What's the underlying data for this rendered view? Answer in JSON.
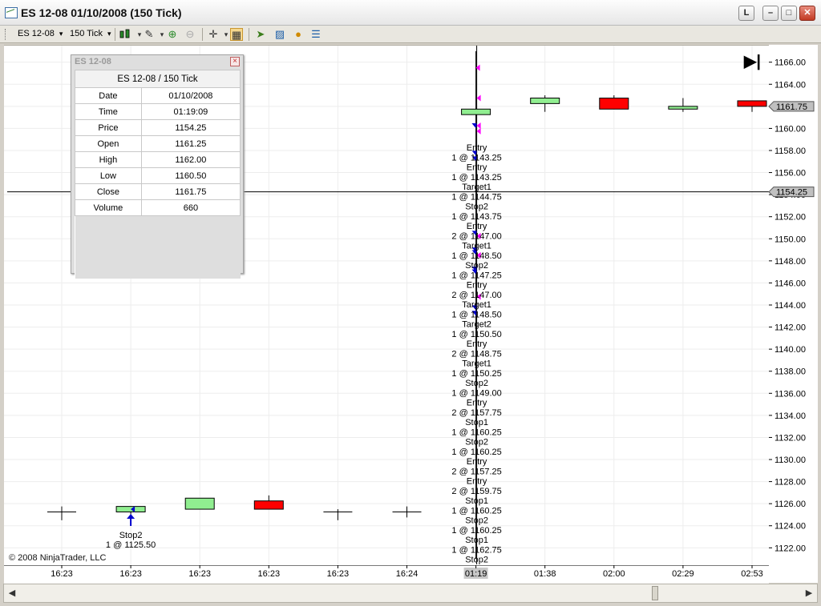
{
  "window": {
    "title": "ES 12-08  01/10/2008 (150 Tick)",
    "buttons": {
      "link": "L",
      "minimize": "–",
      "maximize": "□",
      "close": "✕"
    }
  },
  "toolbar": {
    "instrument": "ES 12-08",
    "interval": "150 Tick"
  },
  "data_window": {
    "title": "ES 12-08",
    "header": "ES 12-08 / 150 Tick",
    "rows": [
      {
        "label": "Date",
        "value": "01/10/2008"
      },
      {
        "label": "Time",
        "value": "01:19:09"
      },
      {
        "label": "Price",
        "value": "1154.25"
      },
      {
        "label": "Open",
        "value": "1161.25"
      },
      {
        "label": "High",
        "value": "1162.00"
      },
      {
        "label": "Low",
        "value": "1160.50"
      },
      {
        "label": "Close",
        "value": "1161.75"
      },
      {
        "label": "Volume",
        "value": "660"
      }
    ]
  },
  "copyright": "© 2008 NinjaTrader, LLC",
  "chart_data": {
    "type": "candlestick",
    "ylim": [
      1120.5,
      1167.5
    ],
    "y_ticks": [
      1122,
      1124,
      1126,
      1128,
      1130,
      1132,
      1134,
      1136,
      1138,
      1140,
      1142,
      1144,
      1146,
      1148,
      1150,
      1152,
      1154,
      1156,
      1158,
      1160,
      1162,
      1164,
      1166
    ],
    "y_tick_labels": [
      "1122.00",
      "1124.00",
      "1126.00",
      "1128.00",
      "1130.00",
      "1132.00",
      "1134.00",
      "1136.00",
      "1138.00",
      "1140.00",
      "1142.00",
      "1144.00",
      "1146.00",
      "1148.00",
      "1150.00",
      "1152.00",
      "1154.00",
      "1156.00",
      "1158.00",
      "1160.00",
      "1162.00",
      "1164.00",
      "1166.00"
    ],
    "x_labels": [
      "16:23",
      "16:23",
      "16:23",
      "16:23",
      "16:23",
      "16:24",
      "01:19",
      "01:38",
      "02:00",
      "02:29",
      "02:53"
    ],
    "highlighted_x_label": "01:19",
    "grid": true,
    "bars": [
      {
        "time": "16:23",
        "open": 1125.25,
        "high": 1125.75,
        "low": 1124.5,
        "close": 1125.25
      },
      {
        "time": "16:23",
        "open": 1125.25,
        "high": 1125.75,
        "low": 1125.0,
        "close": 1125.75
      },
      {
        "time": "16:23",
        "open": 1125.5,
        "high": 1126.5,
        "low": 1125.5,
        "close": 1126.5
      },
      {
        "time": "16:23",
        "open": 1126.25,
        "high": 1126.75,
        "low": 1125.5,
        "close": 1125.5
      },
      {
        "time": "16:23",
        "open": 1125.25,
        "high": 1125.5,
        "low": 1124.5,
        "close": 1125.25
      },
      {
        "time": "16:24",
        "open": 1125.25,
        "high": 1125.75,
        "low": 1124.75,
        "close": 1125.25
      },
      {
        "time": "01:19",
        "open": 1161.25,
        "high": 1167.0,
        "low": 1121.0,
        "close": 1161.75
      },
      {
        "time": "01:38",
        "open": 1162.25,
        "high": 1163.0,
        "low": 1161.5,
        "close": 1162.75
      },
      {
        "time": "02:00",
        "open": 1162.75,
        "high": 1163.0,
        "low": 1161.75,
        "close": 1161.75
      },
      {
        "time": "02:29",
        "open": 1161.75,
        "high": 1162.75,
        "low": 1161.5,
        "close": 1162.0
      },
      {
        "time": "02:53",
        "open": 1162.5,
        "high": 1162.5,
        "low": 1161.5,
        "close": 1162.0
      }
    ],
    "last_price_label": "1161.75",
    "crosshair_price": 1154.25,
    "crosshair_price_label": "1154.25",
    "execution_labels": [
      "Entry",
      "1 @ 1143.25",
      "Entry",
      "1 @ 1143.25",
      "Target1",
      "1 @ 1144.75",
      "Stop2",
      "1 @ 1143.75",
      "Entry",
      "2 @ 1147.00",
      "Target1",
      "1 @ 1148.50",
      "Stop2",
      "1 @ 1147.25",
      "Entry",
      "2 @ 1147.00",
      "Target1",
      "1 @ 1148.50",
      "Target2",
      "1 @ 1150.50",
      "Entry",
      "2 @ 1148.75",
      "Target1",
      "1 @ 1150.25",
      "Stop2",
      "1 @ 1149.00",
      "Entry",
      "2 @ 1157.75",
      "Stop1",
      "1 @ 1160.25",
      "Stop2",
      "1 @ 1160.25",
      "Entry",
      "2 @ 1157.25",
      "Entry",
      "2 @ 1159.75",
      "Stop1",
      "1 @ 1160.25",
      "Stop2",
      "1 @ 1160.25",
      "Stop1",
      "1 @ 1162.75",
      "Stop2"
    ],
    "early_execution": {
      "label": "Stop2",
      "detail": "1 @ 1125.50",
      "price": 1125.5
    },
    "colors": {
      "up": "#90ee90",
      "down": "#ff0000",
      "buy_marker": "#0000cc",
      "sell_marker": "#ff00ff"
    }
  }
}
